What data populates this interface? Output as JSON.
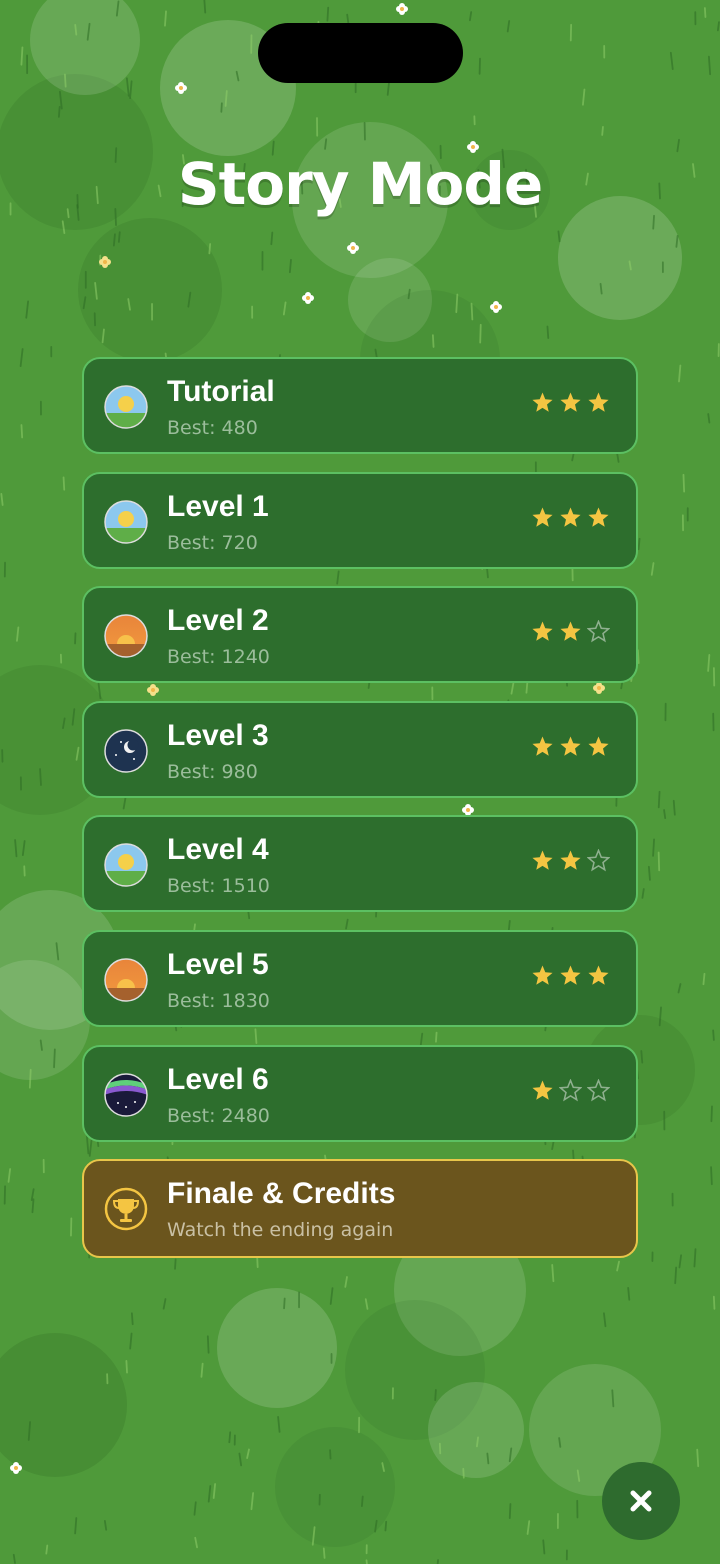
{
  "screen": {
    "title": "Story Mode"
  },
  "levels": [
    {
      "name": "Tutorial",
      "best": "Best: 480",
      "stars": 3,
      "theme": "day-icon"
    },
    {
      "name": "Level 1",
      "best": "Best: 720",
      "stars": 3,
      "theme": "day-icon"
    },
    {
      "name": "Level 2",
      "best": "Best: 1240",
      "stars": 2,
      "theme": "sunset-icon"
    },
    {
      "name": "Level 3",
      "best": "Best: 980",
      "stars": 3,
      "theme": "night-moon-icon"
    },
    {
      "name": "Level 4",
      "best": "Best: 1510",
      "stars": 2,
      "theme": "day-icon"
    },
    {
      "name": "Level 5",
      "best": "Best: 1830",
      "stars": 3,
      "theme": "sunset-icon"
    },
    {
      "name": "Level 6",
      "best": "Best: 2480",
      "stars": 1,
      "theme": "aurora-icon"
    }
  ],
  "max_stars": 3,
  "finale": {
    "name": "Finale & Credits",
    "subtitle": "Watch the ending again",
    "icon": "trophy-icon"
  },
  "close_icon": "close-icon",
  "colors": {
    "background": "#4f9a3a",
    "card_bg": "#2d6e2d",
    "card_border": "#5cc062",
    "finale_bg": "#6b551d",
    "finale_border": "#e8c64a",
    "star_filled": "#f4c542",
    "star_empty": "#8fb08f"
  }
}
